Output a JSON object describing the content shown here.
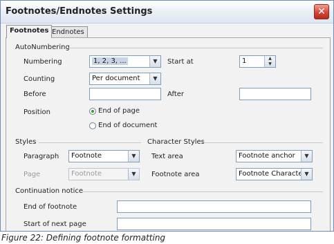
{
  "dialog": {
    "title": "Footnotes/Endnotes Settings",
    "close_icon": "close-icon"
  },
  "tabs": [
    "Footnotes",
    "Endnotes"
  ],
  "autonumbering": {
    "section": "AutoNumbering",
    "numbering_label": "Numbering",
    "numbering_value": "1, 2, 3, ...",
    "start_at_label": "Start at",
    "start_at_value": "1",
    "counting_label": "Counting",
    "counting_value": "Per document",
    "before_label": "Before",
    "before_value": "",
    "after_label": "After",
    "after_value": "",
    "position_label": "Position",
    "position_options": [
      "End of page",
      "End of document"
    ],
    "position_selected": "End of page"
  },
  "styles": {
    "section": "Styles",
    "paragraph_label": "Paragraph",
    "paragraph_value": "Footnote",
    "page_label": "Page",
    "page_value": "Footnote"
  },
  "character_styles": {
    "section": "Character Styles",
    "text_area_label": "Text area",
    "text_area_value": "Footnote anchor",
    "footnote_area_label": "Footnote area",
    "footnote_area_value": "Footnote Characters"
  },
  "continuation": {
    "section": "Continuation notice",
    "end_label": "End of footnote",
    "end_value": "",
    "start_label": "Start of next page",
    "start_value": ""
  },
  "caption": "Figure 22: Defining footnote formatting"
}
